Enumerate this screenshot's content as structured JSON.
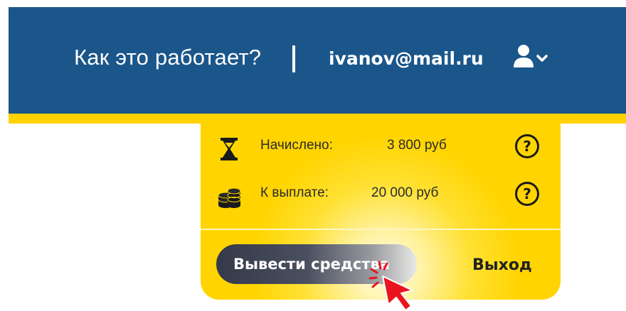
{
  "header": {
    "how_it_works": "Как это работает?",
    "divider": "|",
    "email": "ivanov@mail.ru",
    "user_icon": "user-icon",
    "chevron_icon": "chevron-down-icon"
  },
  "panel": {
    "rows": [
      {
        "icon": "hourglass-icon",
        "label": "Начислено:",
        "value": "3 800 руб",
        "help": "?"
      },
      {
        "icon": "coins-icon",
        "label": "К выплате:",
        "value": "20 000 руб",
        "help": "?"
      }
    ],
    "withdraw_label": "Вывести средства",
    "logout_label": "Выход"
  },
  "colors": {
    "header_bg": "#1b568a",
    "accent_yellow": "#ffd200",
    "button_dark": "#35394a",
    "cursor_red": "#e8141e"
  }
}
